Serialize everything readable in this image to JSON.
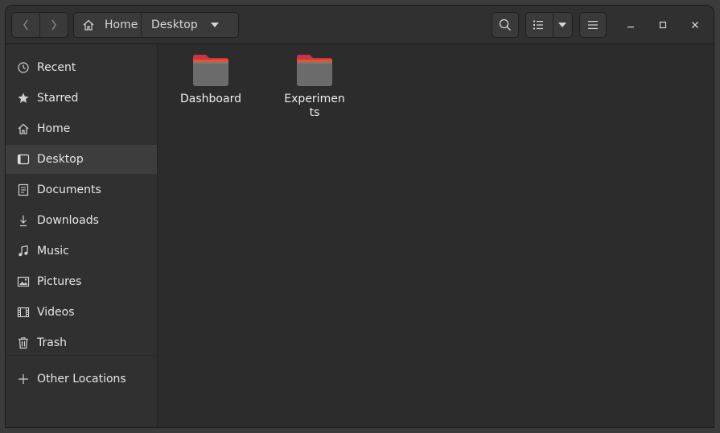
{
  "header": {
    "back_icon": "chevron-left-icon",
    "forward_icon": "chevron-right-icon",
    "breadcrumb": {
      "home_label": "Home",
      "current_label": "Desktop"
    }
  },
  "sidebar": {
    "items": [
      {
        "label": "Recent",
        "icon": "clock-icon",
        "active": false
      },
      {
        "label": "Starred",
        "icon": "star-icon",
        "active": false
      },
      {
        "label": "Home",
        "icon": "home-icon",
        "active": false
      },
      {
        "label": "Desktop",
        "icon": "desktop-icon",
        "active": true
      },
      {
        "label": "Documents",
        "icon": "document-icon",
        "active": false
      },
      {
        "label": "Downloads",
        "icon": "download-icon",
        "active": false
      },
      {
        "label": "Music",
        "icon": "music-icon",
        "active": false
      },
      {
        "label": "Pictures",
        "icon": "picture-icon",
        "active": false
      },
      {
        "label": "Videos",
        "icon": "video-icon",
        "active": false
      },
      {
        "label": "Trash",
        "icon": "trash-icon",
        "active": false
      }
    ],
    "other_locations": "Other Locations"
  },
  "content": {
    "files": [
      {
        "name": "Dashboard",
        "type": "folder"
      },
      {
        "name": "Experiments",
        "type": "folder"
      }
    ]
  },
  "colors": {
    "folder_body": "#6b6b6b",
    "folder_tab": "#c8344e",
    "folder_accent": "#e95420",
    "sidebar_active": "#3d3d3d"
  }
}
